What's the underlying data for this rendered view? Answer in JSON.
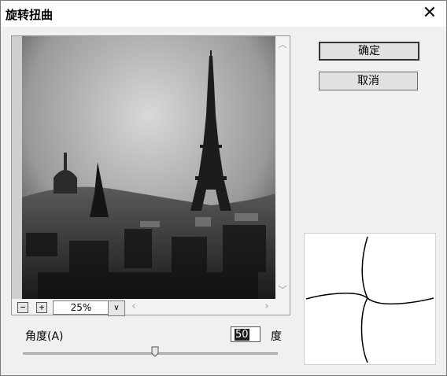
{
  "window": {
    "title": "旋转扭曲",
    "close_glyph": "✕"
  },
  "buttons": {
    "ok": "确定",
    "cancel": "取消"
  },
  "zoom": {
    "value": "25%",
    "zoom_out": "−",
    "zoom_in": "+"
  },
  "angle": {
    "label": "角度(A)",
    "value": "50",
    "unit": "度",
    "slider_fraction": 0.52
  },
  "scroll": {
    "up": "︿",
    "down": "﹀",
    "left": "‹",
    "right": "›",
    "drop": "∨"
  },
  "preview": {
    "description_icon": "photo-preview"
  },
  "colors": {
    "background": "#f0f0f0",
    "titlebar": "#ffffff",
    "accent_selection": "#1e1e1e"
  }
}
